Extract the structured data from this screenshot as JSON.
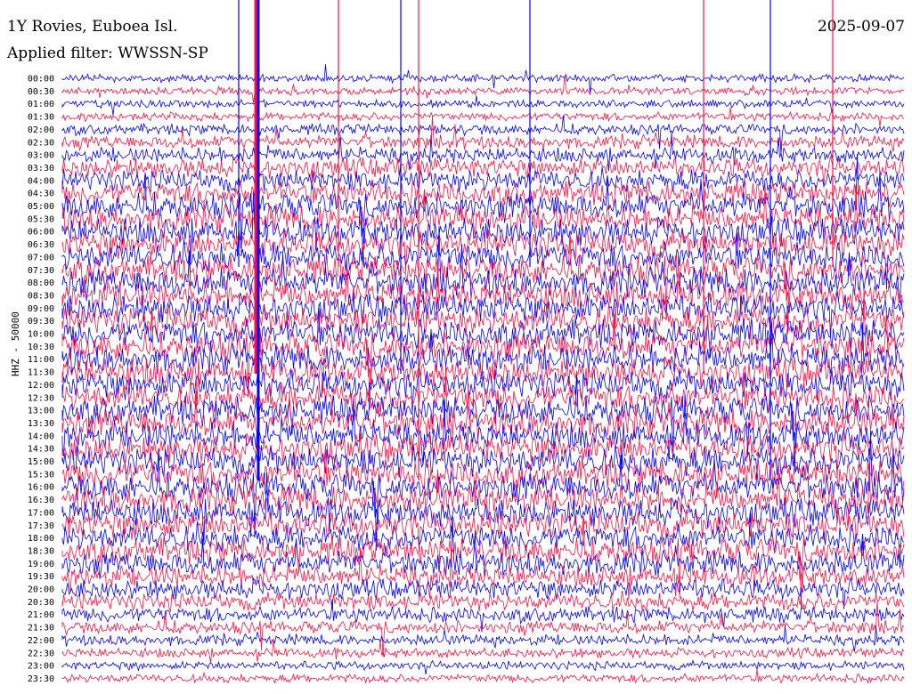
{
  "header": {
    "station": "1Y Rovies, Euboea Isl.",
    "filter": "Applied filter: WWSSN-SP",
    "date": "2025-09-07"
  },
  "axis": {
    "channel_label": "HHZ - 50000"
  },
  "colors": {
    "trace_a": "#ff1040",
    "trace_b": "#0000ff",
    "background": "#ffffff"
  },
  "chart_data": {
    "type": "line",
    "row_labels": [
      "00:00",
      "00:30",
      "01:00",
      "01:30",
      "02:00",
      "02:30",
      "03:00",
      "03:30",
      "04:00",
      "04:30",
      "05:00",
      "05:30",
      "06:00",
      "06:30",
      "07:00",
      "07:30",
      "08:00",
      "08:30",
      "09:00",
      "09:30",
      "10:00",
      "10:30",
      "11:00",
      "11:30",
      "12:00",
      "12:30",
      "13:00",
      "13:30",
      "14:00",
      "14:30",
      "15:00",
      "15:30",
      "16:00",
      "16:30",
      "17:00",
      "17:30",
      "18:00",
      "18:30",
      "19:00",
      "19:30",
      "20:00",
      "20:30",
      "21:00",
      "21:30",
      "22:00",
      "22:30",
      "23:00",
      "23:30"
    ],
    "row_colors": [
      "blue",
      "red"
    ],
    "noise_level": [
      0.35,
      0.35,
      0.35,
      0.4,
      0.5,
      0.6,
      0.7,
      0.9,
      1.0,
      1.1,
      1.2,
      1.2,
      1.25,
      1.25,
      1.3,
      1.3,
      1.3,
      1.3,
      1.3,
      1.3,
      1.3,
      1.3,
      1.3,
      1.3,
      1.3,
      1.3,
      1.3,
      1.3,
      1.3,
      1.3,
      1.3,
      1.3,
      1.3,
      1.3,
      1.25,
      1.25,
      1.2,
      1.2,
      1.1,
      1.0,
      0.9,
      0.8,
      0.7,
      0.6,
      0.5,
      0.45,
      0.4,
      0.4
    ]
  }
}
